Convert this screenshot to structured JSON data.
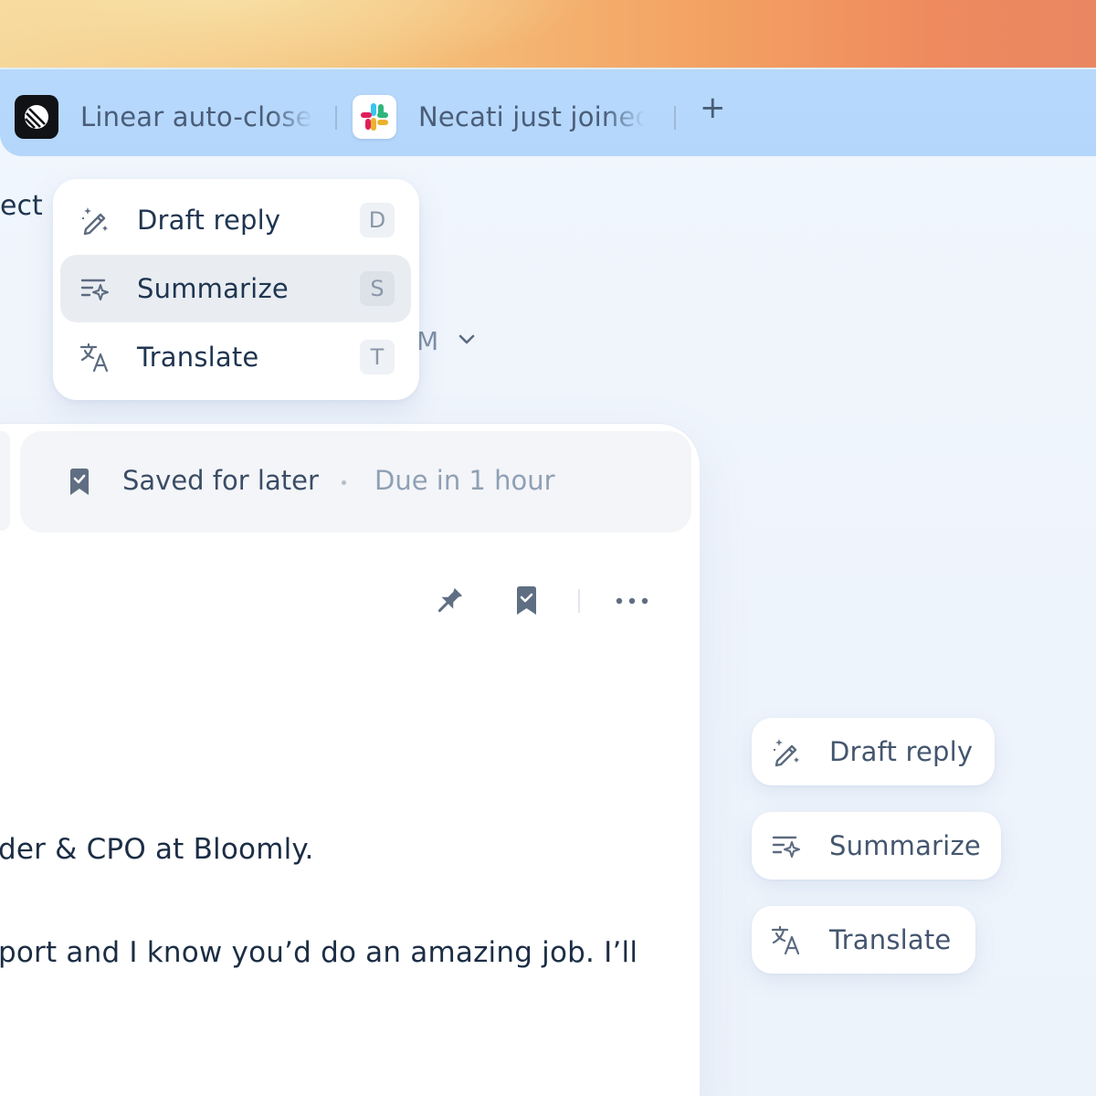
{
  "tabs": [
    {
      "label": "Linear auto-closed",
      "icon": "linear-logo-icon"
    },
    {
      "label": "Necati just joined",
      "icon": "slack-logo-icon"
    }
  ],
  "new_tab_label": "+",
  "partial_text": {
    "top_left": "ect",
    "time_fragment": "M"
  },
  "ai_menu": {
    "items": [
      {
        "label": "Draft reply",
        "shortcut": "D",
        "icon": "magic-wand-icon"
      },
      {
        "label": "Summarize",
        "shortcut": "S",
        "icon": "summarize-sparkle-icon",
        "active": true
      },
      {
        "label": "Translate",
        "shortcut": "T",
        "icon": "translate-icon"
      }
    ]
  },
  "saved_bar": {
    "label": "Saved for later",
    "separator": "·",
    "due": "Due in 1 hour"
  },
  "email_body": {
    "line1": "der & CPO at Bloomly.",
    "line2": "port and I know you’d do an amazing job. I’ll"
  },
  "floating_actions": [
    {
      "label": "Draft reply",
      "icon": "magic-wand-icon"
    },
    {
      "label": "Summarize",
      "icon": "summarize-sparkle-icon"
    },
    {
      "label": "Translate",
      "icon": "translate-icon"
    }
  ],
  "colors": {
    "tabbar": "#b6d8fb",
    "text_primary": "#1f3550",
    "text_muted": "#8fa0b5",
    "menu_active": "#e9edf2",
    "icon": "#5c6b80"
  }
}
